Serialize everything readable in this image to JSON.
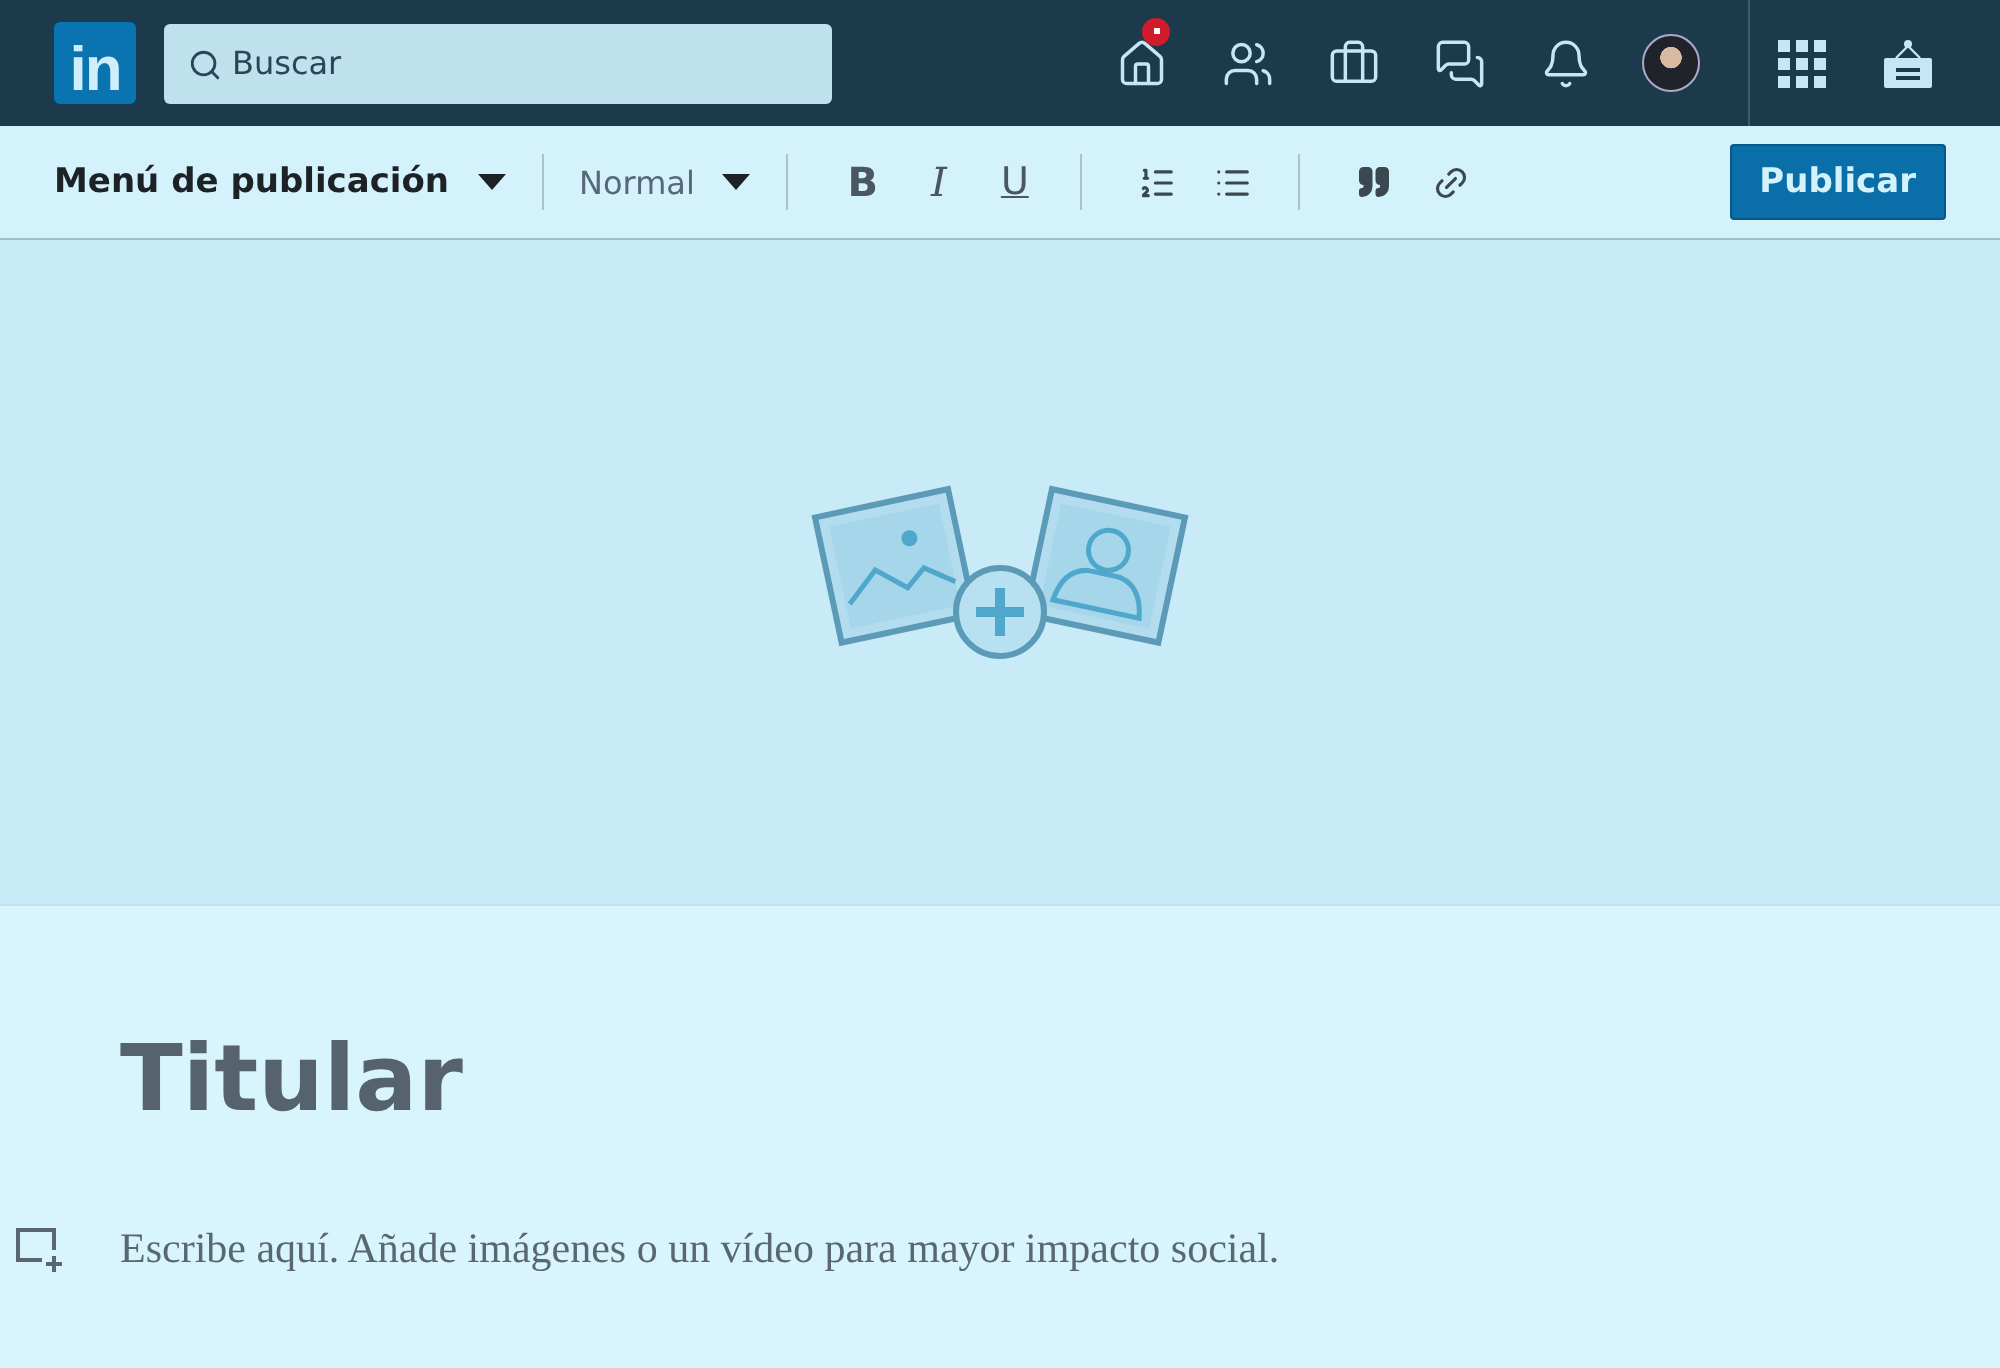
{
  "navbar": {
    "logo": "in",
    "search": {
      "placeholder": "Buscar"
    },
    "home_notification": true
  },
  "toolbar": {
    "menu": "Menú de publicación",
    "text_style": "Normal",
    "format_buttons": [
      {
        "label": "B",
        "kind": "bold"
      },
      {
        "label": "I",
        "kind": "italic"
      },
      {
        "label": "U",
        "kind": "underline"
      }
    ],
    "publish": "Publicar"
  },
  "editor": {
    "headline": {
      "placeholder": "Titular"
    },
    "body": {
      "placeholder": "Escribe aquí. Añade imágenes o un vídeo para mayor impacto social."
    }
  }
}
